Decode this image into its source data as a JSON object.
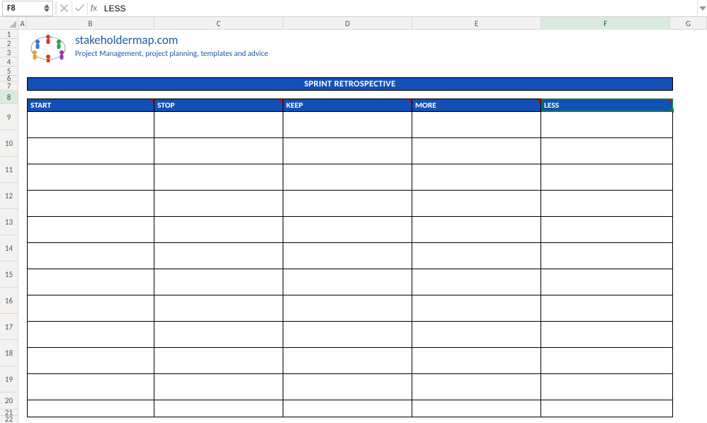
{
  "formula_bar": {
    "cell_ref": "F8",
    "fx_label": "fx",
    "formula_value": "LESS"
  },
  "columns": [
    "A",
    "B",
    "C",
    "D",
    "E",
    "F",
    "G"
  ],
  "rows": [
    "1",
    "2",
    "3",
    "4",
    "5",
    "6",
    "7",
    "8",
    "9",
    "10",
    "11",
    "12",
    "13",
    "14",
    "15",
    "16",
    "17",
    "18",
    "19",
    "20",
    "21",
    "22"
  ],
  "brand": {
    "title": "stakeholdermap.com",
    "subtitle": "Project Management, project planning, templates and advice"
  },
  "sheet": {
    "title_band": "SPRINT RETROSPECTIVE",
    "headers": {
      "B": "START",
      "C": "STOP",
      "D": "KEEP",
      "E": "MORE",
      "F": "LESS"
    },
    "data_rows": [
      {
        "B": "",
        "C": "",
        "D": "",
        "E": "",
        "F": ""
      },
      {
        "B": "",
        "C": "",
        "D": "",
        "E": "",
        "F": ""
      },
      {
        "B": "",
        "C": "",
        "D": "",
        "E": "",
        "F": ""
      },
      {
        "B": "",
        "C": "",
        "D": "",
        "E": "",
        "F": ""
      },
      {
        "B": "",
        "C": "",
        "D": "",
        "E": "",
        "F": ""
      },
      {
        "B": "",
        "C": "",
        "D": "",
        "E": "",
        "F": ""
      },
      {
        "B": "",
        "C": "",
        "D": "",
        "E": "",
        "F": ""
      },
      {
        "B": "",
        "C": "",
        "D": "",
        "E": "",
        "F": ""
      },
      {
        "B": "",
        "C": "",
        "D": "",
        "E": "",
        "F": ""
      },
      {
        "B": "",
        "C": "",
        "D": "",
        "E": "",
        "F": ""
      },
      {
        "B": "",
        "C": "",
        "D": "",
        "E": "",
        "F": ""
      },
      {
        "B": "",
        "C": "",
        "D": "",
        "E": "",
        "F": ""
      }
    ],
    "selected_cell": "F8"
  }
}
